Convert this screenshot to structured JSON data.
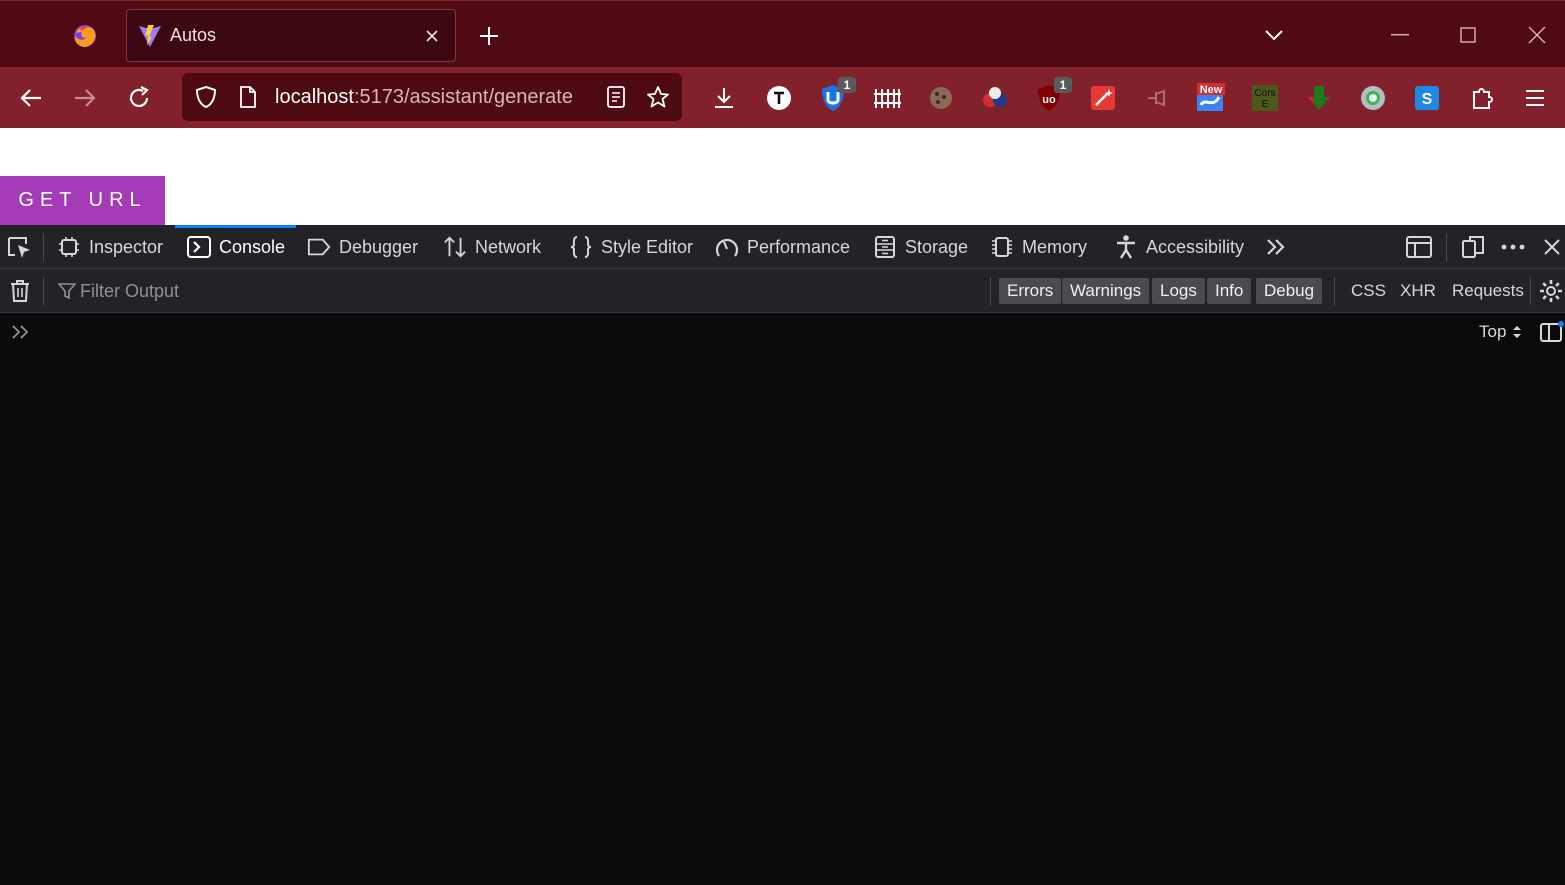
{
  "browser": {
    "tab": {
      "title": "Autos"
    },
    "url": {
      "host": "localhost",
      "path": ":5173/assistant/generate"
    },
    "extensions": [
      {
        "name": "t-extension-icon",
        "badge": ""
      },
      {
        "name": "shield-u-extension-icon",
        "badge": "1"
      },
      {
        "name": "fence-extension-icon",
        "badge": ""
      },
      {
        "name": "cookie-extension-icon",
        "badge": ""
      },
      {
        "name": "balls-extension-icon",
        "badge": ""
      },
      {
        "name": "ublock-extension-icon",
        "badge": "1"
      },
      {
        "name": "magic-wand-extension-icon",
        "badge": ""
      },
      {
        "name": "pin-extension-icon",
        "badge": ""
      },
      {
        "name": "new-extension-icon",
        "badge": "",
        "label": "New"
      },
      {
        "name": "cors-extension-icon",
        "badge": "",
        "label": "Cors E"
      },
      {
        "name": "download-arrow-extension-icon",
        "badge": ""
      },
      {
        "name": "circle-extension-icon",
        "badge": ""
      },
      {
        "name": "s-extension-icon",
        "badge": "",
        "label": "S"
      }
    ]
  },
  "page": {
    "button_label": "GET URL"
  },
  "devtools": {
    "tabs": [
      {
        "label": "Inspector",
        "icon": "inspector-icon"
      },
      {
        "label": "Console",
        "icon": "console-icon",
        "selected": true
      },
      {
        "label": "Debugger",
        "icon": "debugger-icon"
      },
      {
        "label": "Network",
        "icon": "network-icon"
      },
      {
        "label": "Style Editor",
        "icon": "style-editor-icon"
      },
      {
        "label": "Performance",
        "icon": "performance-icon"
      },
      {
        "label": "Storage",
        "icon": "storage-icon"
      },
      {
        "label": "Memory",
        "icon": "memory-icon"
      },
      {
        "label": "Accessibility",
        "icon": "accessibility-icon"
      }
    ],
    "console": {
      "filter_placeholder": "Filter Output",
      "levels": [
        "Errors",
        "Warnings",
        "Logs",
        "Info",
        "Debug"
      ],
      "extra_filters": [
        "CSS",
        "XHR",
        "Requests"
      ],
      "context": "Top"
    }
  },
  "colors": {
    "tabstrip": "#4f0a14",
    "navbar": "#82212b",
    "button": "#a33bb6",
    "devtools_bg": "#232327",
    "console_bg": "#0b0b0c",
    "selected_tab_accent": "#0a84ff"
  }
}
